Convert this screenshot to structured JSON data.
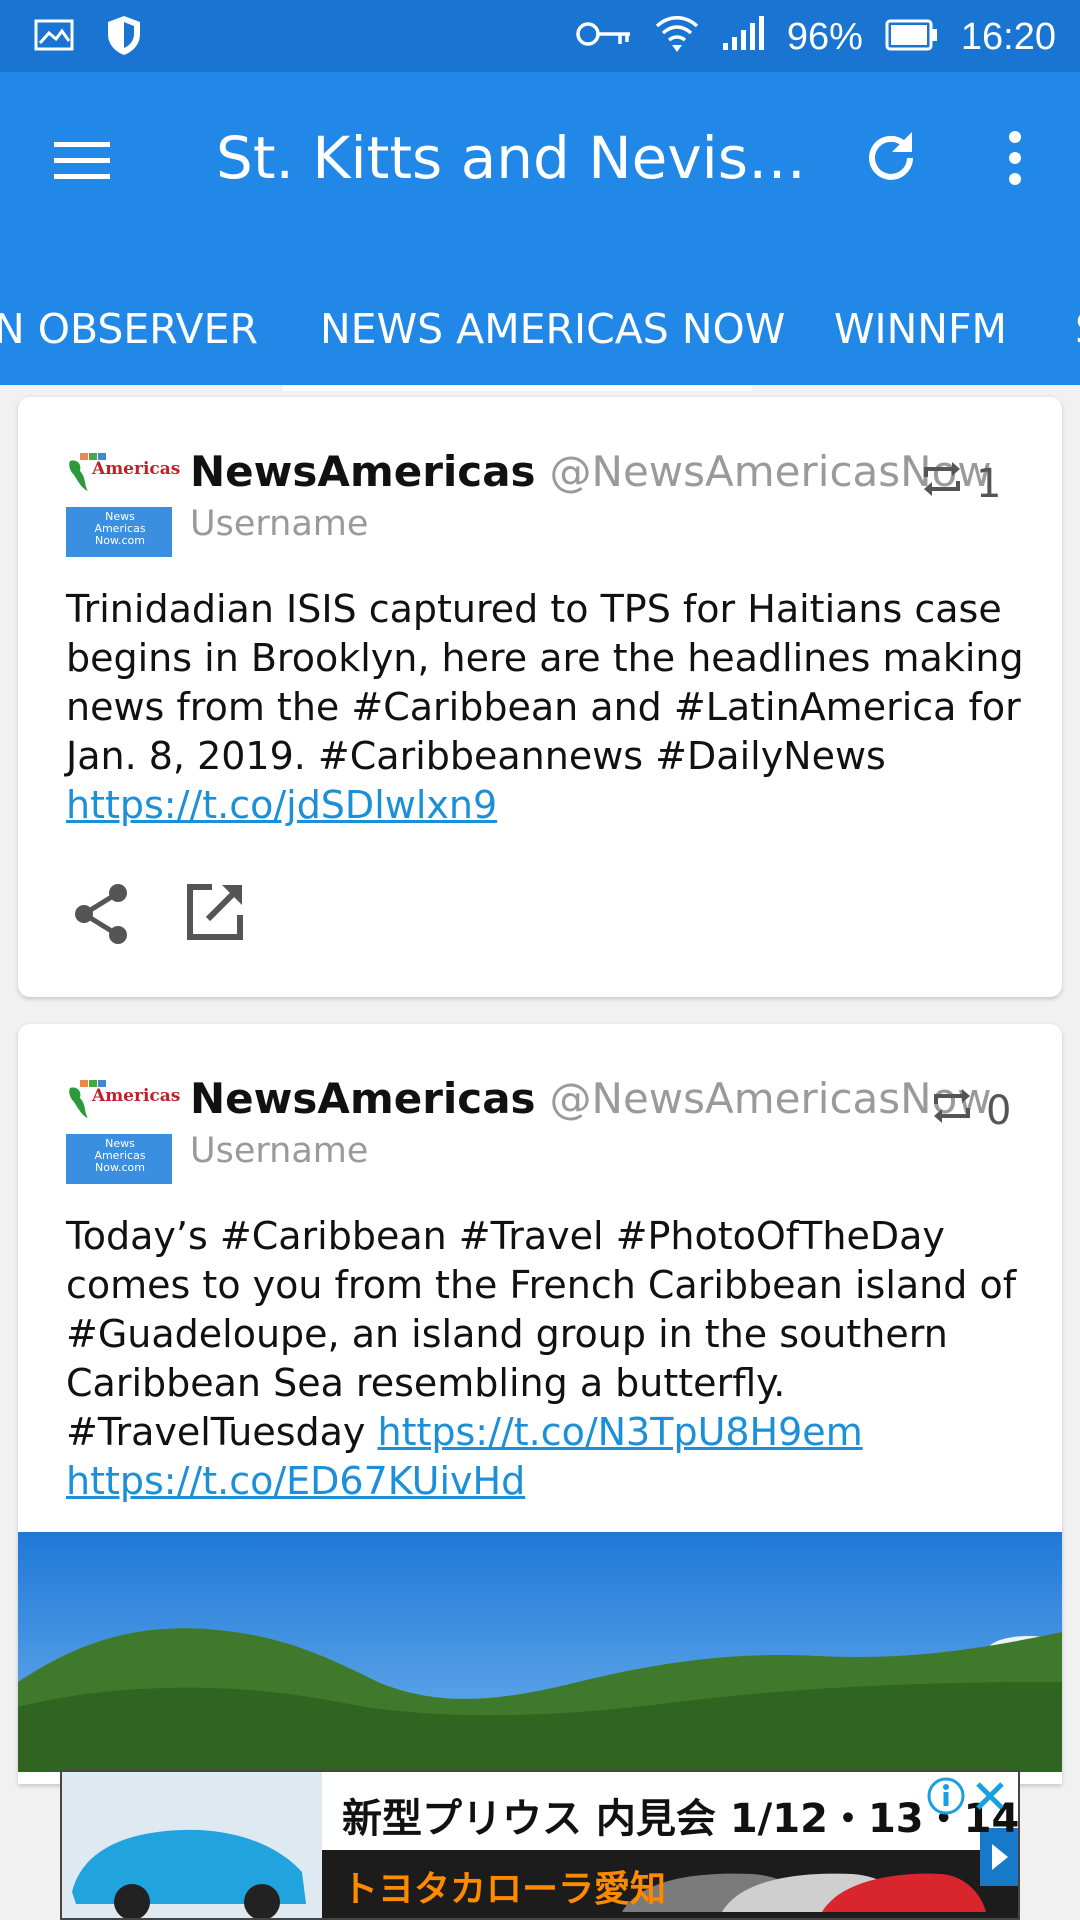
{
  "status_bar": {
    "battery": "96%",
    "time": "16:20"
  },
  "app_bar": {
    "title": "St. Kitts and Nevis…"
  },
  "tabs": [
    {
      "label": "N OBSERVER"
    },
    {
      "label": "NEWS AMERICAS NOW",
      "selected": true
    },
    {
      "label": "WINNFM"
    },
    {
      "label": "S"
    }
  ],
  "tweets": [
    {
      "display_name": "NewsAmericas",
      "handle": "@NewsAmericasNow",
      "username_label": "Username",
      "retweets": "1",
      "avatar_text": {
        "brand": "Americas",
        "bottom": "News Americas Now.com"
      },
      "text_before": "Trinidadian ISIS captured to TPS for Haitians case begins in Brooklyn, here are the headlines making news from the #Caribbean and #LatinAmerica for Jan. 8, 2019. #Caribbeannews #DailyNews",
      "links": [
        "https://t.co/jdSDlwlxn9"
      ]
    },
    {
      "display_name": "NewsAmericas",
      "handle": "@NewsAmericasNow",
      "username_label": "Username",
      "retweets": "0",
      "avatar_text": {
        "brand": "Americas",
        "bottom": "News Americas Now.com"
      },
      "text_before": "Today’s #Caribbean #Travel #PhotoOfTheDay comes to you from the French Caribbean island of #Guadeloupe, an island group in the southern Caribbean Sea resembling a butterfly. #TravelTuesday",
      "links": [
        "https://t.co/N3TpU8H9em",
        "https://t.co/ED67KUivHd"
      ]
    }
  ],
  "ad": {
    "line1": "新型プリウス 内見会 1/12・13・14",
    "line2": "トヨタカローラ愛知"
  },
  "colors": {
    "status_bar": "#1a74d2",
    "app_bar": "#2188e8",
    "link": "#1b8fd8"
  }
}
